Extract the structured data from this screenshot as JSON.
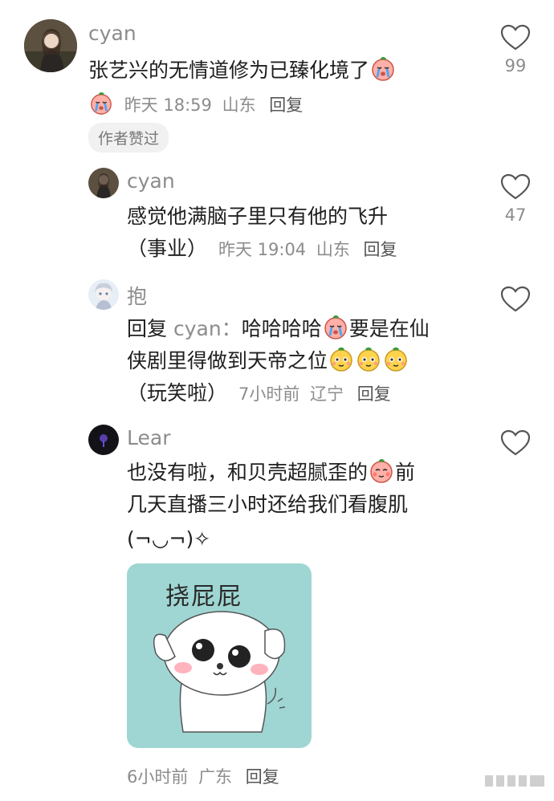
{
  "comments": [
    {
      "username": "cyan",
      "text": "张艺兴的无情道修为已臻化境了",
      "meta": {
        "time": "昨天 18:59",
        "location": "山东",
        "reply": "回复"
      },
      "author_badge": "作者赞过",
      "likes": "99"
    },
    {
      "username": "cyan",
      "text_line1": "感觉他满脑子里只有他的飞升",
      "text_line2": "（事业）",
      "meta": {
        "time": "昨天 19:04",
        "location": "山东",
        "reply": "回复"
      },
      "likes": "47"
    },
    {
      "username": "抱",
      "reply_prefix": "回复",
      "reply_target": "cyan：",
      "text_part1": "哈哈哈哈",
      "text_part2": "要是在仙",
      "text_line2": "侠剧里得做到天帝之位",
      "text_line3": "（玩笑啦）",
      "meta": {
        "time": "7小时前",
        "location": "辽宁",
        "reply": "回复"
      }
    },
    {
      "username": "Lear",
      "text_part1": "也没有啦，和贝壳超腻歪的",
      "text_part2": "前",
      "text_line2": "几天直播三小时还给我们看腹肌",
      "text_line3": "(¬◡¬)✧",
      "sticker_text": "挠屁屁",
      "meta": {
        "time": "6小时前",
        "location": "广东",
        "reply": "回复"
      }
    }
  ],
  "icons": {
    "like": "heart-outline-icon",
    "emoji_cry": "crying-emoji-icon",
    "emoji_peach": "peach-face-emoji-icon"
  },
  "colors": {
    "meta": "#8c8c8c",
    "text": "#202020",
    "sticker_bg": "#9fd6d3"
  }
}
